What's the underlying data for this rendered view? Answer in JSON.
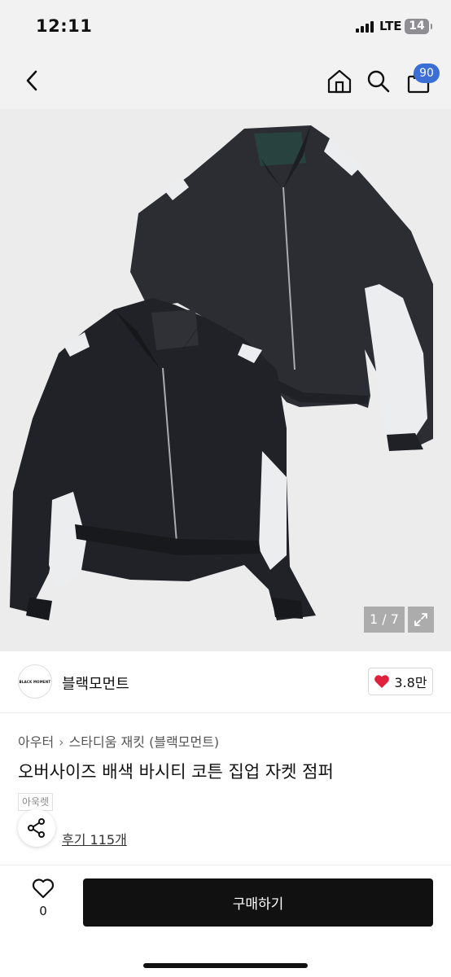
{
  "status_bar": {
    "time": "12:11",
    "network": "LTE",
    "battery": "14"
  },
  "nav": {
    "cart_count": "90"
  },
  "gallery": {
    "page_indicator": "1 / 7"
  },
  "brand": {
    "logo_text": "BLACK MOMENT",
    "name": "블랙모먼트",
    "like_count": "3.8만"
  },
  "product": {
    "category": {
      "main": "아우터",
      "sub": "스타디움 재킷 (블랙모먼트)"
    },
    "title": "오버사이즈 배색 바시티 코튼 집업 자켓 점퍼",
    "tag": "아욱렛",
    "review_link": "후기 115개"
  },
  "bottom_bar": {
    "wish_count": "0",
    "buy_label": "구매하기"
  },
  "colors": {
    "accent_badge": "#3b6fd6",
    "heart": "#e0203c",
    "buy_button": "#111111"
  }
}
